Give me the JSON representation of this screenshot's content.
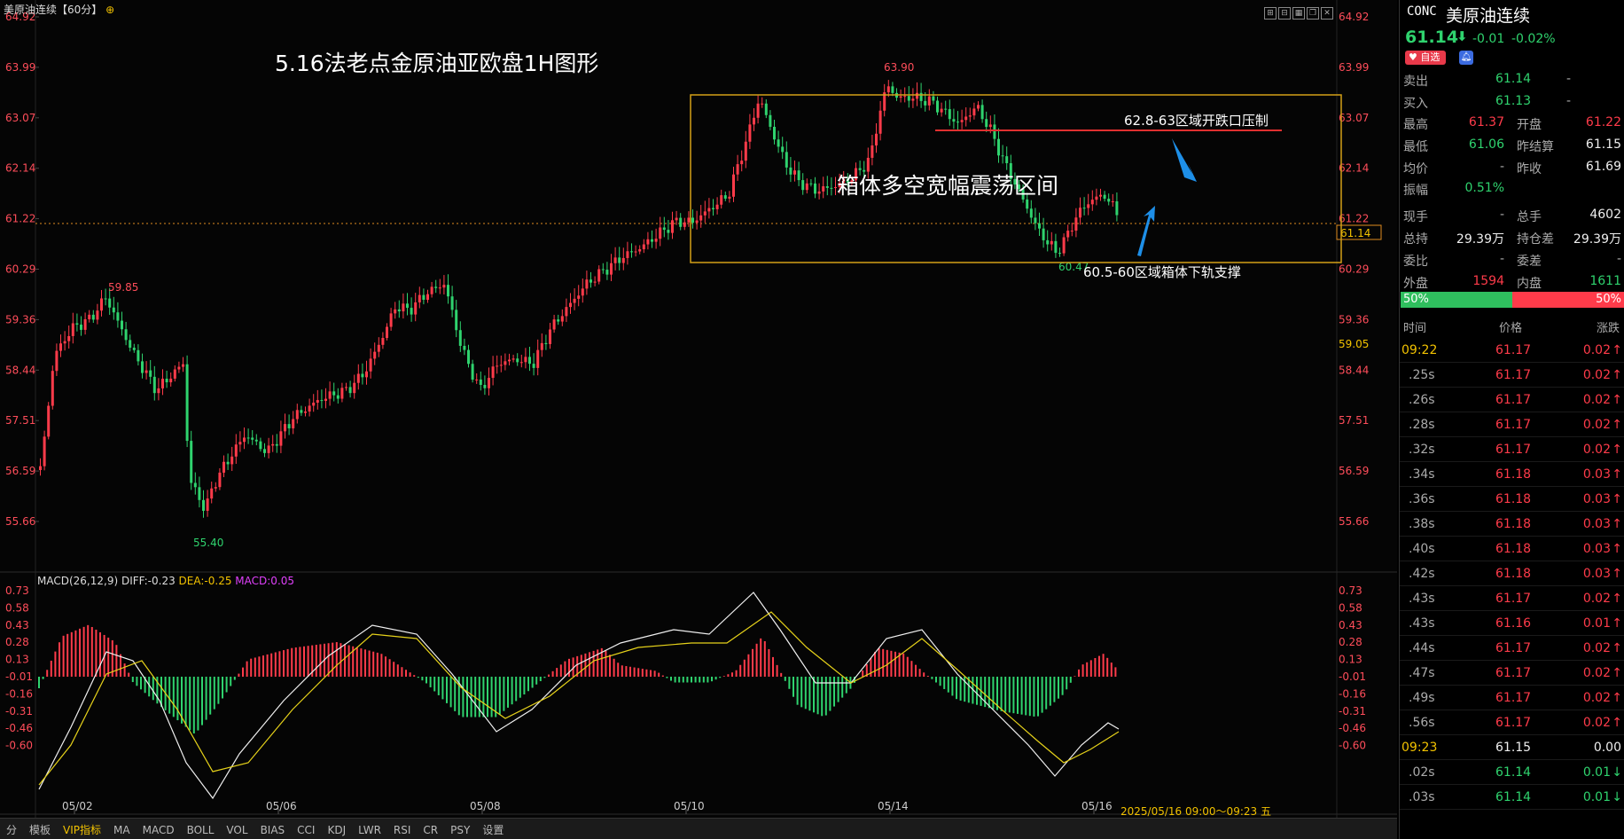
{
  "chart_header": {
    "instrument": "美原油连续【60分】",
    "settings_icon": "settings-icon"
  },
  "chart_title": "5.16法老点金原油亚欧盘1H图形",
  "annotations": {
    "box_label": "箱体多空宽幅震荡区间",
    "resistance_label": "62.8-63区域开跌口压制",
    "support_label": "60.5-60区域箱体下轨支撑",
    "high_marker": "63.90",
    "low_marker": "60.47",
    "left_high": "59.85",
    "bottom_low": "55.40"
  },
  "price_axis": {
    "ticks": [
      "64.92",
      "63.99",
      "63.07",
      "62.14",
      "61.22",
      "60.29",
      "59.36",
      "58.44",
      "57.51",
      "56.59",
      "55.66"
    ],
    "current_price_label": "61.14",
    "alt_label": "59.05"
  },
  "date_axis": {
    "labels": [
      "05/02",
      "05/06",
      "05/08",
      "05/10",
      "05/14",
      "05/16"
    ],
    "range_label": "2025/05/16 09:00～09:23 五"
  },
  "macd": {
    "label": "MACD(26,12,9)",
    "diff": "DIFF:-0.23",
    "dea": "DEA:-0.25",
    "macd": "MACD:0.05",
    "ticks": [
      "0.73",
      "0.58",
      "0.43",
      "0.28",
      "0.13",
      "-0.01",
      "-0.16",
      "-0.31",
      "-0.46",
      "-0.60"
    ]
  },
  "toolbar": {
    "items": [
      "分",
      "模板",
      "VIP指标",
      "MA",
      "MACD",
      "BOLL",
      "VOL",
      "BIAS",
      "CCI",
      "KDJ",
      "LWR",
      "RSI",
      "CR",
      "PSY",
      "设置"
    ]
  },
  "sidebar": {
    "code": "CONC",
    "name": "美原油连续",
    "price": "61.14",
    "change": "-0.01",
    "change_pct": "-0.02%",
    "watch_label": "自选",
    "sell_label": "卖出",
    "sell_price": "61.14",
    "sell_vol": "-",
    "buy_label": "买入",
    "buy_price": "61.13",
    "buy_vol": "-",
    "stats": [
      [
        "最高",
        "61.37",
        "开盘",
        "61.22"
      ],
      [
        "最低",
        "61.06",
        "昨结算",
        "61.15"
      ],
      [
        "均价",
        "-",
        "昨收",
        "61.69"
      ],
      [
        "振幅",
        "0.51%",
        "",
        ""
      ],
      [
        "现手",
        "-",
        "总手",
        "4602"
      ],
      [
        "总持",
        "29.39万",
        "持仓差",
        "29.39万"
      ],
      [
        "委比",
        "-",
        "委差",
        "-"
      ],
      [
        "外盘",
        "1594",
        "内盘",
        "1611"
      ]
    ],
    "ratio_left": "50%",
    "ratio_right": "50%",
    "tick_header": [
      "时间",
      "价格",
      "涨跌"
    ],
    "ticks": [
      [
        "09:22",
        "61.17",
        "0.02",
        "up"
      ],
      [
        ".25s",
        "61.17",
        "0.02",
        "up"
      ],
      [
        ".26s",
        "61.17",
        "0.02",
        "up"
      ],
      [
        ".28s",
        "61.17",
        "0.02",
        "up"
      ],
      [
        ".32s",
        "61.17",
        "0.02",
        "up"
      ],
      [
        ".34s",
        "61.18",
        "0.03",
        "up"
      ],
      [
        ".36s",
        "61.18",
        "0.03",
        "up"
      ],
      [
        ".38s",
        "61.18",
        "0.03",
        "up"
      ],
      [
        ".40s",
        "61.18",
        "0.03",
        "up"
      ],
      [
        ".42s",
        "61.18",
        "0.03",
        "up"
      ],
      [
        ".43s",
        "61.17",
        "0.02",
        "up"
      ],
      [
        ".43s",
        "61.16",
        "0.01",
        "up"
      ],
      [
        ".44s",
        "61.17",
        "0.02",
        "up"
      ],
      [
        ".47s",
        "61.17",
        "0.02",
        "up"
      ],
      [
        ".49s",
        "61.17",
        "0.02",
        "up"
      ],
      [
        ".56s",
        "61.17",
        "0.02",
        "up"
      ],
      [
        "09:23",
        "61.15",
        "0.00",
        "flat"
      ],
      [
        ".02s",
        "61.14",
        "0.01",
        "down"
      ],
      [
        ".03s",
        "61.14",
        "0.01",
        "down"
      ]
    ]
  },
  "colors": {
    "up": "#ff3b4a",
    "down": "#2fd36e",
    "box": "#d4a017",
    "accent_yellow": "#f2c200"
  }
}
